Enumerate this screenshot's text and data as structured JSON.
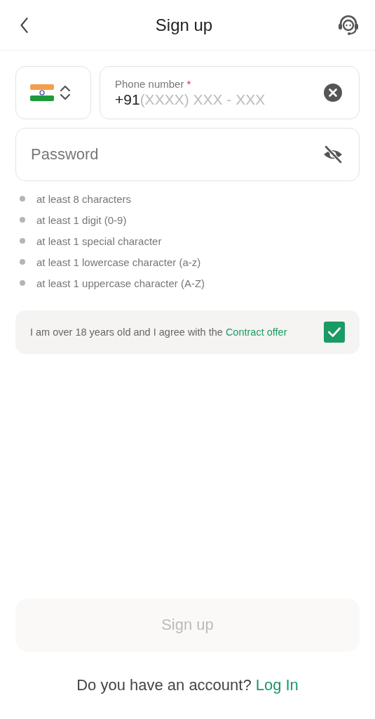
{
  "header": {
    "title": "Sign up"
  },
  "phone": {
    "label": "Phone number",
    "required_mark": "*",
    "prefix": "+91",
    "placeholder": "(XXXX) XXX - XXX"
  },
  "password": {
    "placeholder": "Password",
    "hidden": true
  },
  "rules": [
    {
      "text": "at least 8 characters",
      "met": false
    },
    {
      "text": "at least 1 digit (0-9)",
      "met": false
    },
    {
      "text": "at least 1 special character",
      "met": false
    },
    {
      "text": "at least 1 lowercase character (a-z)",
      "met": false
    },
    {
      "text": "at least 1 uppercase character (A-Z)",
      "met": false
    }
  ],
  "agreement": {
    "text": "I am over 18 years old and I agree with the",
    "link": "Contract offer",
    "checked": true
  },
  "submit": {
    "label": "Sign up",
    "disabled": true
  },
  "footer": {
    "text": "Do you have an account?",
    "link": "Log In"
  }
}
